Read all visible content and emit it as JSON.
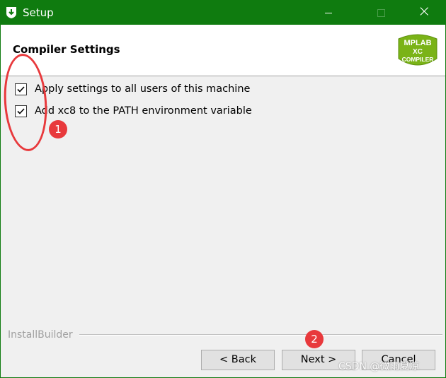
{
  "window": {
    "title": "Setup",
    "controls": {
      "minimize": "minimize",
      "maximize": "maximize",
      "close": "×"
    }
  },
  "header": {
    "title": "Compiler Settings",
    "logo": {
      "line1": "MPLAB",
      "line2": "XC",
      "line3": "COMPILER"
    }
  },
  "options": [
    {
      "label": "Apply settings to all users of this machine",
      "checked": true
    },
    {
      "label": "Add xc8 to the PATH environment variable",
      "checked": true
    }
  ],
  "footer": {
    "brand": "InstallBuilder",
    "back_label": "< Back",
    "next_label": "Next >",
    "cancel_label": "Cancel"
  },
  "annotations": {
    "marker1": "1",
    "marker2": "2",
    "color": "#e8393c"
  },
  "watermark": "CSDN @微雨夏凉",
  "colors": {
    "titlebar": "#0f7b0f",
    "logo_green": "#7ab317",
    "body": "#f0f0f0"
  }
}
